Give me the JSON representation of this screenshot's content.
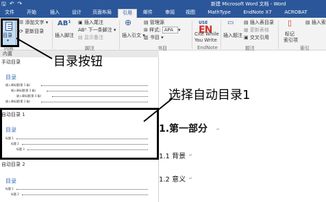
{
  "window": {
    "title": "新建 Microsoft Word 文档 - Word",
    "qat": [
      "🖫",
      "↶",
      "↷"
    ]
  },
  "tabs": [
    "文件",
    "开始",
    "插入",
    "设计",
    "页面布局",
    "引用",
    "邮件",
    "审阅",
    "视图",
    "MathType",
    "EndNote X7",
    "ACROBAT"
  ],
  "active_tab": "引用",
  "ribbon": {
    "toc_button_label": "目录",
    "toc_group_label": "内容",
    "add_text": "添加文字",
    "update_toc": "更新目录",
    "insert_footnote": "插入脚注",
    "insert_endnote": "插入尾注",
    "next_footnote": "下一条脚注",
    "show_notes": "显示备注",
    "footnote_group": "脚注",
    "insert_citation": "插入引文",
    "manage_sources": "管理源",
    "style_label": "样式:",
    "style_value": "APA",
    "bibliography": "书目",
    "citations_group": "书目",
    "endnote_top": "USE",
    "endnote_logo": "EN",
    "cite_while": "Cite While",
    "you_write": "You Write",
    "endnote_group": "EndNote",
    "insert_caption": "插入题注",
    "insert_table_of_figures": "插入表目录",
    "update_table": "更新表格",
    "cross_reference": "交叉引用",
    "captions_group": "题注",
    "mark_entry": "标记",
    "mark_entry2": "索引项",
    "index_group": "索引",
    "insert_index": "插入索引"
  },
  "dropdown": {
    "header": "内置",
    "section_manual": "手动目录",
    "section_auto1": "自动目录 1",
    "section_auto2": "自动目录 2",
    "toc_title": "目录",
    "manual_lines": [
      "键入章标题(第 1 级)",
      "键入章标题(第 2 级)",
      "键入章标题(第 3 级)",
      "键入章标题(第 1 级)"
    ],
    "auto_lines": [
      "标题 1",
      "标题 2",
      "标题 3"
    ]
  },
  "annotations": {
    "toc_button_callout": "目录按钮",
    "auto_toc_callout": "选择自动目录1"
  },
  "document": {
    "heading1": "1.第一部分",
    "heading2a": "1.1 背景",
    "heading2b": "1.2 意义"
  }
}
